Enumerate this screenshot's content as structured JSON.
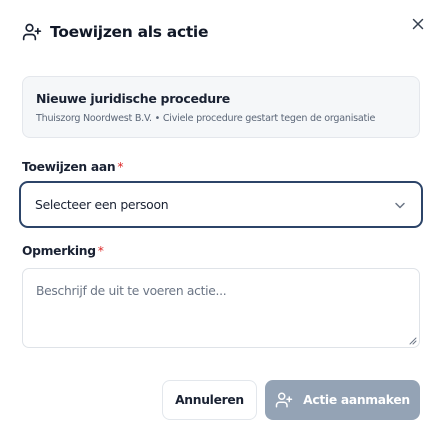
{
  "dialog": {
    "title": "Toewijzen als actie",
    "title_icon": "user-plus-icon",
    "close_icon": "close-icon"
  },
  "case": {
    "name": "Nieuwe juridische procedure",
    "details": "Thuiszorg Noordwest B.V. • Civiele procedure gestart tegen de organisatie"
  },
  "assign": {
    "label": "Toewijzen aan",
    "required_mark": "*",
    "selected": "Selecteer een persoon",
    "chevron_icon": "chevron-down-icon"
  },
  "remark": {
    "label": "Opmerking",
    "required_mark": "*",
    "placeholder": "Beschrijf de uit te voeren actie..."
  },
  "actions": {
    "cancel_label": "Annuleren",
    "create_label": "Actie aanmaken",
    "create_icon": "user-plus-icon"
  },
  "colors": {
    "primary_disabled": "#94a3b5",
    "focus_border": "#2c4468",
    "required": "#dc2626"
  }
}
